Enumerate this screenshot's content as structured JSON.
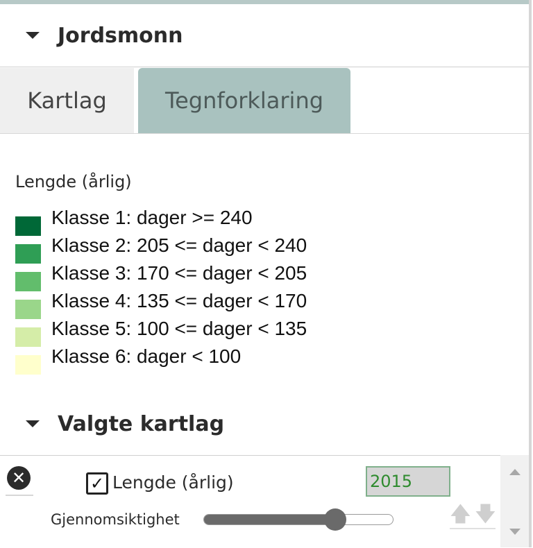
{
  "sections": {
    "jordsmonn": {
      "title": "Jordsmonn"
    },
    "valgte": {
      "title": "Valgte kartlag"
    }
  },
  "tabs": [
    {
      "label": "Kartlag",
      "active": false
    },
    {
      "label": "Tegnforklaring",
      "active": true
    }
  ],
  "legend": {
    "title": "Lengde (årlig)",
    "items": [
      {
        "label": "Klasse 1: dager >= 240",
        "color": "#006837"
      },
      {
        "label": "Klasse 2: 205 <= dager < 240",
        "color": "#2f9e55"
      },
      {
        "label": "Klasse 3: 170 <= dager < 205",
        "color": "#62bd6c"
      },
      {
        "label": "Klasse 4: 135 <= dager < 170",
        "color": "#9ad68a"
      },
      {
        "label": "Klasse 5: 100 <= dager < 135",
        "color": "#d5eda8"
      },
      {
        "label": "Klasse 6: dager < 100",
        "color": "#ffffcc"
      }
    ]
  },
  "selected_layer": {
    "name": "Lengde (årlig)",
    "checked": true,
    "year": "2015",
    "opacity_label": "Gjennomsiktighet",
    "opacity": 0.72
  },
  "icons": {
    "remove": "close-circle-icon",
    "checkbox": "checkbox-checked-icon",
    "move_up": "arrow-up-icon",
    "move_down": "arrow-down-icon"
  },
  "colors": {
    "active_tab": "#a9c2bf",
    "inactive_tab": "#efefef",
    "year_text": "#2e8b2e"
  }
}
